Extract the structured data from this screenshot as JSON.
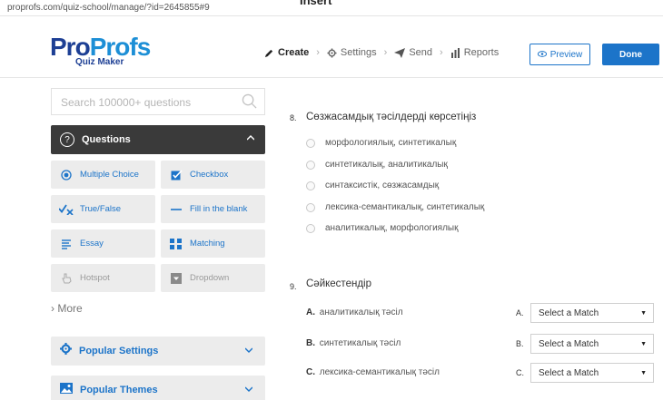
{
  "browser": {
    "url": "proprofs.com/quiz-school/manage/?id=2645855#9",
    "top_cut_text": "Insert"
  },
  "header": {
    "logo_pro": "Pro",
    "logo_profs": "Profs",
    "logo_sub": "Quiz Maker",
    "nav": {
      "create": "Create",
      "settings": "Settings",
      "send": "Send",
      "reports": "Reports"
    },
    "preview_label": "Preview",
    "done_label": "Done"
  },
  "sidebar": {
    "search_placeholder": "Search 100000+ questions",
    "questions_label": "Questions",
    "questions_badge": "?",
    "types": {
      "multiple_choice": "Multiple Choice",
      "checkbox": "Checkbox",
      "true_false": "True/False",
      "fill_blank": "Fill in the blank",
      "essay": "Essay",
      "matching": "Matching",
      "hotspot": "Hotspot",
      "dropdown": "Dropdown"
    },
    "more_label": "More",
    "popular_settings": "Popular Settings",
    "popular_themes": "Popular Themes"
  },
  "main": {
    "q8": {
      "number": "8.",
      "title": "Сөзжасамдық тәсілдерді көрсетіңіз",
      "options": [
        "морфологиялық, синтетикалық",
        "синтетикалық, аналитикалық",
        "синтаксистік, сөзжасамдық",
        "лексика-семантикалық, синтетикалық",
        "аналитикалық, морфологиялық"
      ]
    },
    "q9": {
      "number": "9.",
      "title": "Сәйкестендір",
      "rows": [
        {
          "prefix": "A.",
          "text": "аналитикалық тәсіл",
          "letter": "A.",
          "select": "Select a Match"
        },
        {
          "prefix": "B.",
          "text": "синтетикалық тәсіл",
          "letter": "B.",
          "select": "Select a Match"
        },
        {
          "prefix": "C.",
          "text": "лексика-семантикалық тәсіл",
          "letter": "C.",
          "select": "Select a Match"
        }
      ]
    }
  },
  "colors": {
    "accent": "#1c74c9",
    "brand_dark": "#1d3f94",
    "dark_panel": "#3a3a3a"
  }
}
